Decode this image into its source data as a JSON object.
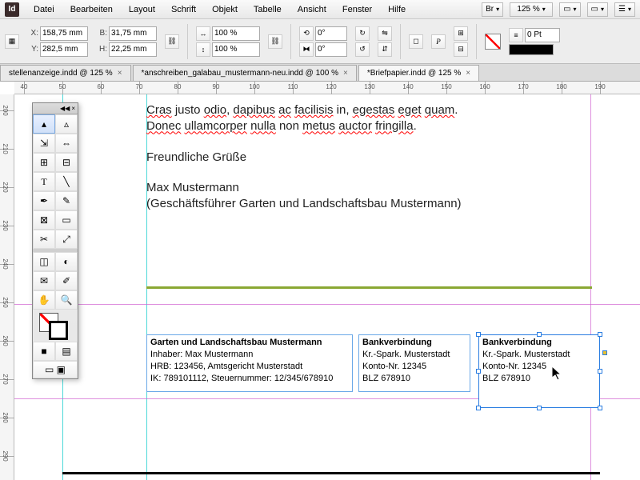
{
  "app": {
    "logo": "Id"
  },
  "menu": [
    "Datei",
    "Bearbeiten",
    "Layout",
    "Schrift",
    "Objekt",
    "Tabelle",
    "Ansicht",
    "Fenster",
    "Hilfe"
  ],
  "topright": {
    "br": "Br",
    "zoom": "125 %"
  },
  "control": {
    "x": "158,75 mm",
    "y": "282,5 mm",
    "w": "31,75 mm",
    "h": "22,25 mm",
    "scalex": "100 %",
    "scaley": "100 %",
    "rotate": "0°",
    "shear": "0°",
    "stroke_pt": "0 Pt"
  },
  "tabs": [
    {
      "label": "stellenanzeige.indd @ 125 %",
      "active": false
    },
    {
      "label": "*anschreiben_galabau_mustermann-neu.indd @ 100 %",
      "active": false
    },
    {
      "label": "*Briefpapier.indd @ 125 %",
      "active": true
    }
  ],
  "hruler_ticks": [
    40,
    50,
    60,
    70,
    80,
    90,
    100,
    110,
    120,
    130,
    140,
    150,
    160,
    170,
    180,
    190
  ],
  "vruler_ticks": [
    200,
    210,
    220,
    230,
    240,
    250,
    260,
    270,
    280,
    290
  ],
  "doc": {
    "line1_parts": [
      "Cras",
      " justo ",
      "odio",
      ", ",
      "dapibus",
      " ",
      "ac",
      " ",
      "facilisis",
      " in, ",
      "egestas",
      " ",
      "eget",
      " ",
      "quam",
      "."
    ],
    "line2_parts": [
      "Donec",
      " ",
      "ullamcorper",
      " ",
      "nulla",
      " non ",
      "metus",
      " ",
      "auctor",
      " ",
      "fringilla",
      "."
    ],
    "greeting": "Freundliche Grüße",
    "name": "Max Mustermann",
    "role": "(Geschäftsführer Garten und Landschaftsbau Mustermann)"
  },
  "footer1": {
    "title": "Garten und Landschaftsbau Mustermann",
    "l1": "Inhaber: Max Mustermann",
    "l2": "HRB: 123456, Amtsgericht Musterstadt",
    "l3": "IK: 789101112, Steuernummer: 12/345/678910"
  },
  "footer2": {
    "title": "Bankverbindung",
    "l1": "Kr.-Spark. Musterstadt",
    "l2": "Konto-Nr. 12345",
    "l3": "BLZ 678910"
  },
  "footer3": {
    "title": "Bankverbindung",
    "l1": "Kr.-Spark. Musterstadt",
    "l2": "Konto-Nr. 12345",
    "l3": "BLZ 678910"
  }
}
